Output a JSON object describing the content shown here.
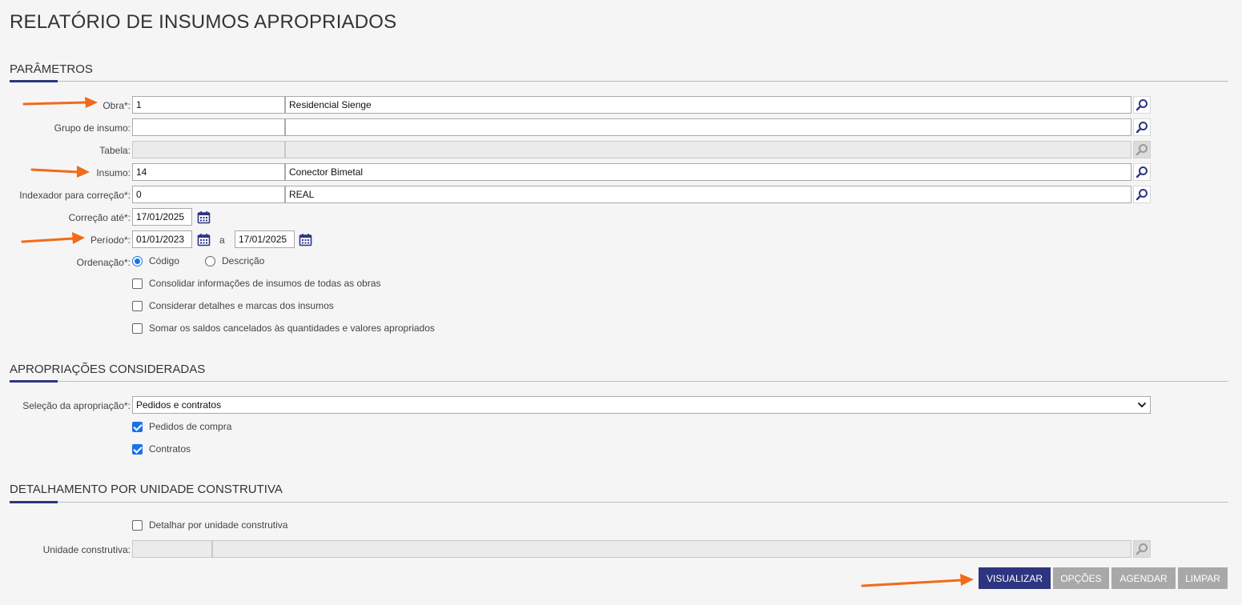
{
  "page": {
    "title": "RELATÓRIO DE INSUMOS APROPRIADOS"
  },
  "sections": {
    "parametros": "PARÂMETROS",
    "apropriacoes": "APROPRIAÇÕES CONSIDERADAS",
    "detalhamento": "DETALHAMENTO POR UNIDADE CONSTRUTIVA"
  },
  "fields": {
    "obra": {
      "label": "Obra*:",
      "code": "1",
      "description": "Residencial Sienge"
    },
    "grupo": {
      "label": "Grupo de insumo:",
      "code": "",
      "description": ""
    },
    "tabela": {
      "label": "Tabela:",
      "code": "",
      "description": ""
    },
    "insumo": {
      "label": "Insumo:",
      "code": "14",
      "description": "Conector Bimetal"
    },
    "indexador": {
      "label": "Indexador para correção*:",
      "code": "0",
      "description": "REAL"
    },
    "correcao": {
      "label": "Correção até*:",
      "value": "17/01/2025"
    },
    "periodo": {
      "label": "Período*:",
      "start": "01/01/2023",
      "separator": "a",
      "end": "17/01/2025"
    },
    "ordenacao": {
      "label": "Ordenação*:",
      "options": [
        "Código",
        "Descrição"
      ],
      "selected": "Código"
    }
  },
  "checkboxes": {
    "consolidar": {
      "label": "Consolidar informações de insumos de todas as obras",
      "checked": false
    },
    "detalhes": {
      "label": "Considerar detalhes e marcas dos insumos",
      "checked": false
    },
    "somar": {
      "label": "Somar os saldos cancelados às quantidades e valores apropriados",
      "checked": false
    }
  },
  "apropriacao": {
    "label": "Seleção da apropriação*:",
    "selected": "Pedidos e contratos",
    "pedidos": {
      "label": "Pedidos de compra",
      "checked": true
    },
    "contratos": {
      "label": "Contratos",
      "checked": true
    }
  },
  "unidade": {
    "detalhar": {
      "label": "Detalhar por unidade construtiva",
      "checked": false
    },
    "label": "Unidade construtiva:",
    "code": "",
    "description": ""
  },
  "buttons": {
    "visualizar": "VISUALIZAR",
    "opcoes": "OPÇÕES",
    "agendar": "AGENDAR",
    "limpar": "LIMPAR"
  },
  "colors": {
    "primary": "#2d3580",
    "secondary_button": "#a8a8a8",
    "arrow": "#f26a1b",
    "checkbox": "#1a73e8"
  },
  "icons": [
    "search-icon",
    "calendar-icon",
    "arrow-annotation"
  ]
}
